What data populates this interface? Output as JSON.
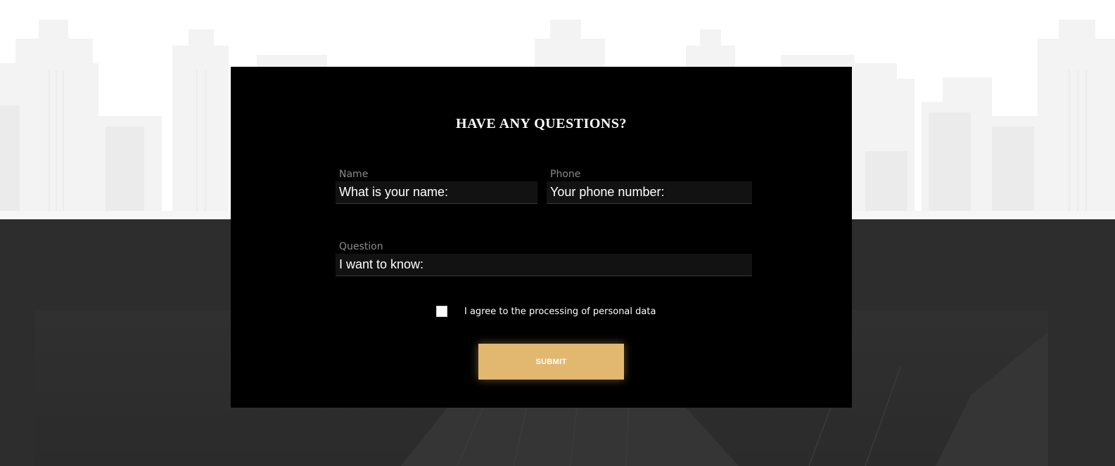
{
  "form": {
    "title": "HAVE ANY QUESTIONS?",
    "fields": {
      "name": {
        "label": "Name",
        "placeholder": "What is your name:"
      },
      "phone": {
        "label": "Phone",
        "placeholder": "Your phone number:"
      },
      "question": {
        "label": "Question",
        "placeholder": "I want to know:"
      }
    },
    "agreement": {
      "label": "I agree to the processing of personal data",
      "checked": false
    },
    "submit_label": "SUBMIT"
  },
  "colors": {
    "card_background": "#000000",
    "input_background": "#121212",
    "label_color": "#8a8a8a",
    "accent": "#e2b871",
    "lower_section": "#2d2d2d"
  }
}
